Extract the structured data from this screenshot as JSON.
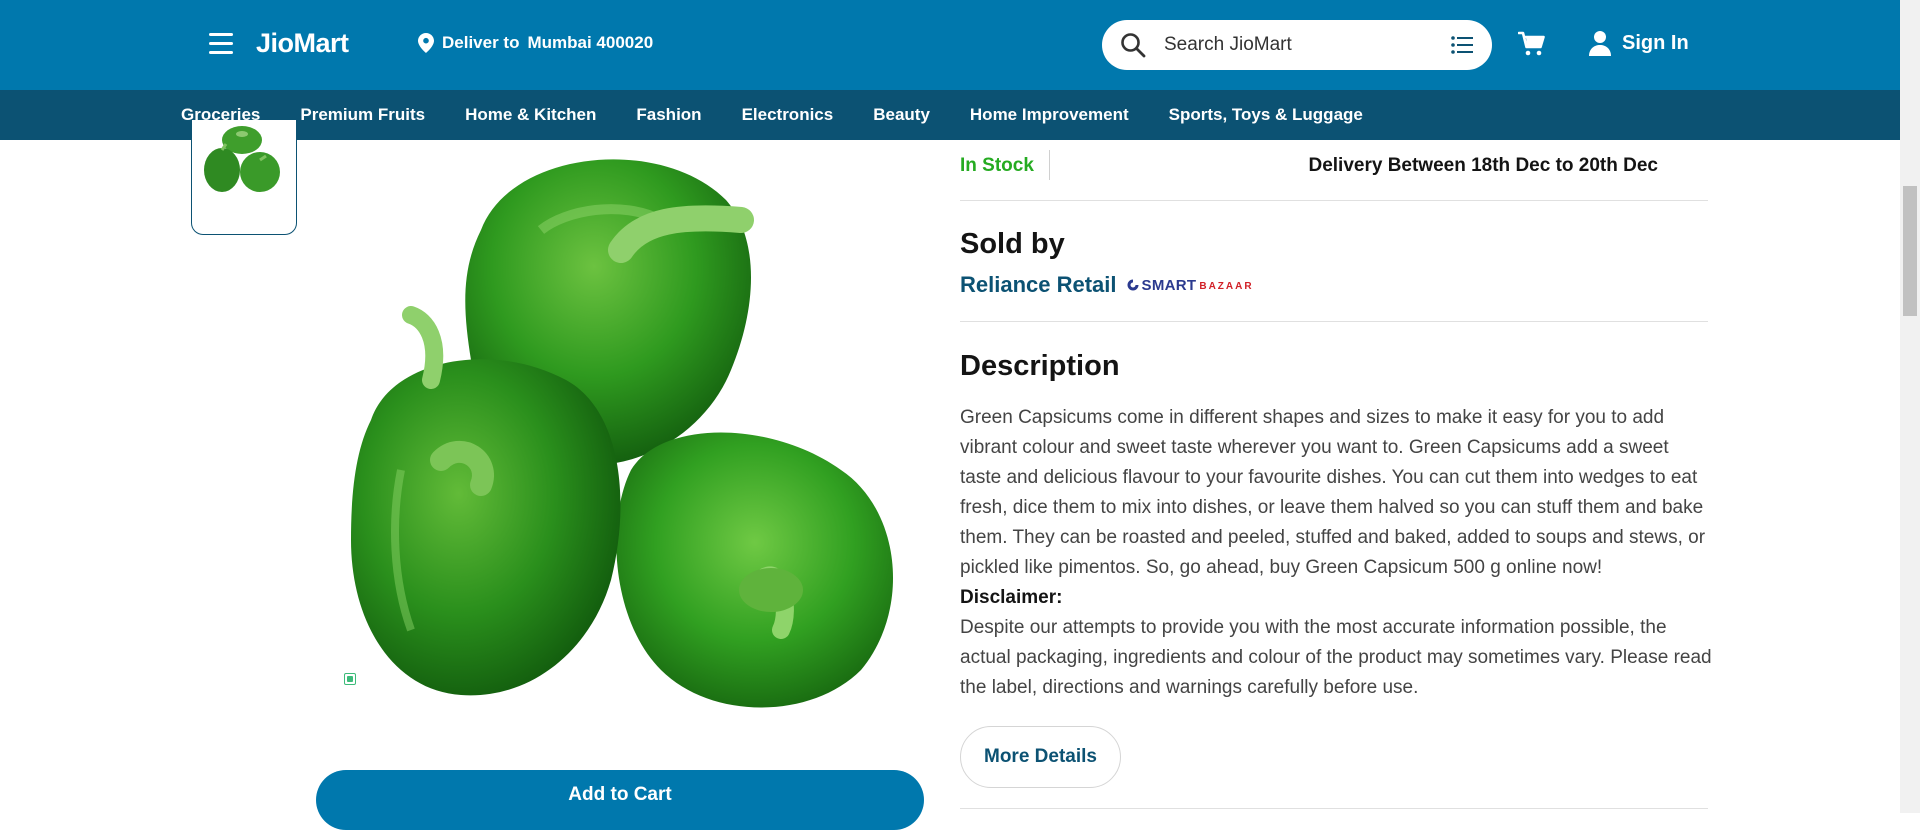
{
  "header": {
    "logo": "JioMart",
    "deliver_label": "Deliver to",
    "deliver_location": "Mumbai 400020",
    "search_placeholder": "Search JioMart",
    "signin_label": "Sign In",
    "brand_color": "#0078ad"
  },
  "categories": [
    "Groceries",
    "Premium Fruits",
    "Home & Kitchen",
    "Fashion",
    "Electronics",
    "Beauty",
    "Home Improvement",
    "Sports, Toys & Luggage"
  ],
  "product": {
    "stock_status": "In Stock",
    "delivery_text": "Delivery Between 18th Dec to 20th Dec",
    "sold_by_title": "Sold by",
    "seller_name": "Reliance Retail",
    "seller_logo_main": "SMART",
    "seller_logo_sub": "BAZAAR",
    "description_title": "Description",
    "description": "Green Capsicums come in different shapes and sizes to make it easy for you to add vibrant colour and sweet taste wherever you want to. Green Capsicums add a sweet taste and delicious flavour to your favourite dishes. You can cut them into wedges to eat fresh, dice them to mix into dishes, or leave them halved so you can stuff them and bake them. They can be roasted and peeled, stuffed and baked, added to soups and stews, or pickled like pimentos. So, go ahead, buy Green Capsicum 500 g online now!",
    "disclaimer_title": "Disclaimer:",
    "disclaimer": "Despite our attempts to provide you with the most accurate information possible, the actual packaging, ingredients and colour of the product may sometimes vary. Please read the label, directions and warnings carefully before use.",
    "more_details_label": "More Details",
    "add_to_cart_label": "Add to Cart"
  },
  "colors": {
    "in_stock": "#25ab21",
    "nav_dark": "#0c5273",
    "veg_mark": "#3dbb7a"
  }
}
